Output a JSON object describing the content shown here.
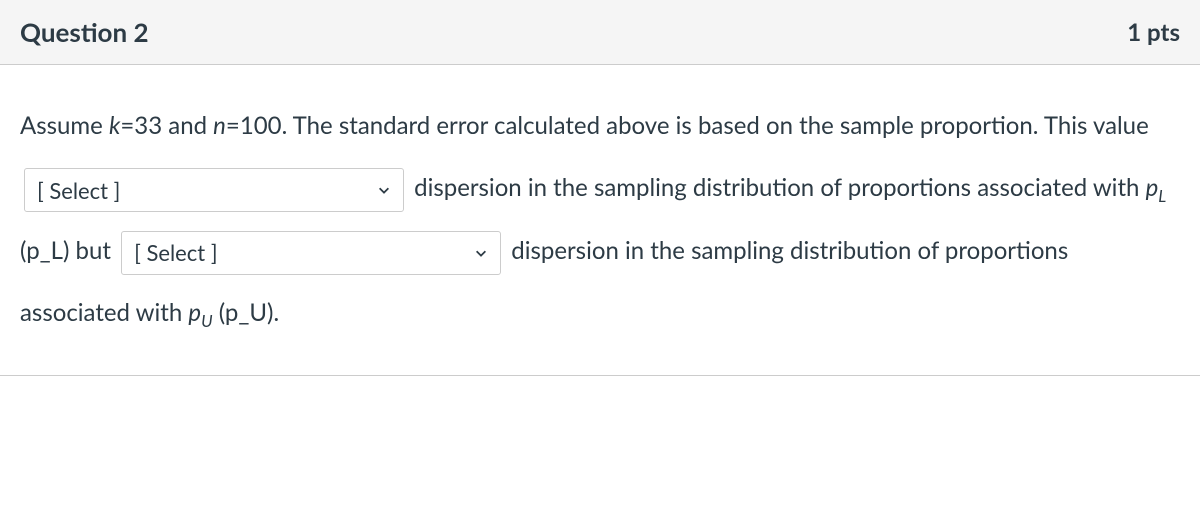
{
  "header": {
    "title": "Question 2",
    "points": "1 pts"
  },
  "body": {
    "text1": "Assume ",
    "var_k": "k",
    "text_eq1": "=33 and ",
    "var_n": "n",
    "text_eq2": "=100. The standard error calculated above is based on the sample proportion. This value ",
    "select1": "[ Select ]",
    "text3": " dispersion in the sampling distribution of proportions associated with ",
    "var_p": "p",
    "sub_L": "L",
    "text_pl": " (p_L) but ",
    "select2": "[ Select ]",
    "text4": " dispersion in the sampling distribution of proportions associated with ",
    "var_p2": "p",
    "sub_U": "U",
    "text_pu": " (p_U)."
  }
}
